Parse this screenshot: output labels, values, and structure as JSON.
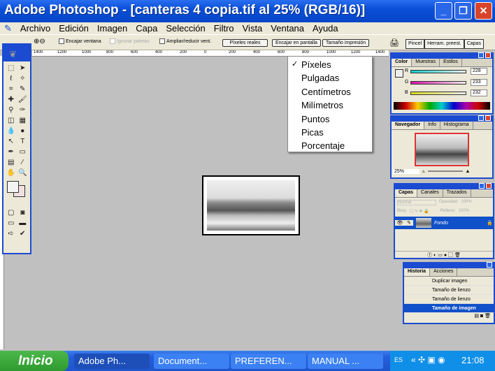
{
  "window": {
    "title": "Adobe Photoshop - [canteras 4 copia.tif al 25% (RGB/16)]",
    "min": "_",
    "max": "❐",
    "close": "✕"
  },
  "menubar": [
    "Archivo",
    "Edición",
    "Imagen",
    "Capa",
    "Selección",
    "Filtro",
    "Vista",
    "Ventana",
    "Ayuda"
  ],
  "options": {
    "fit_window": "Encajar ventana",
    "ignore_palettes": "Ignorar paletas",
    "resize": "Ampliar/reducir vent.",
    "actual_pixels": "Píxeles reales",
    "fit_screen": "Encajar en pantalla",
    "print_size": "Tamaño impresión",
    "well_tabs": [
      "Pincel",
      "Herram. preest.",
      "Capas"
    ]
  },
  "ruler": [
    "1400",
    "1200",
    "1000",
    "800",
    "600",
    "400",
    "200",
    "0",
    "200",
    "400",
    "600",
    "800",
    "1000",
    "1200",
    "1400"
  ],
  "units_menu": {
    "checked": "✓",
    "items": [
      "Píxeles",
      "Pulgadas",
      "Centímetros",
      "Milímetros",
      "Puntos",
      "Picas",
      "Porcentaje"
    ]
  },
  "color_panel": {
    "tabs": [
      "Color",
      "Muestras",
      "Estilos"
    ],
    "channels": [
      {
        "label": "R",
        "value": "228"
      },
      {
        "label": "G",
        "value": "233"
      },
      {
        "label": "B",
        "value": "232"
      }
    ]
  },
  "navigator_panel": {
    "tabs": [
      "Navegador",
      "Info",
      "Histograma"
    ],
    "zoom": "25%"
  },
  "layers_panel": {
    "tabs": [
      "Capas",
      "Canales",
      "Trazados"
    ],
    "blend": "Normal",
    "opacity_label": "Opacidad:",
    "opacity": "100%",
    "lock_label": "Bloq:",
    "fill_label": "Relleno:",
    "fill": "100%",
    "layer": "Fondo"
  },
  "history_panel": {
    "tabs": [
      "Historia",
      "Acciones"
    ],
    "items": [
      "Duplicar imagen",
      "Tamaño de lienzo",
      "Tamaño de lienzo",
      "Tamaño de imagen"
    ]
  },
  "taskbar": {
    "start": "Inicio",
    "tasks": [
      "Adobe Ph...",
      "Document...",
      "PREFEREN...",
      "MANUAL ..."
    ],
    "lang": "ES",
    "clock": "21:08"
  }
}
